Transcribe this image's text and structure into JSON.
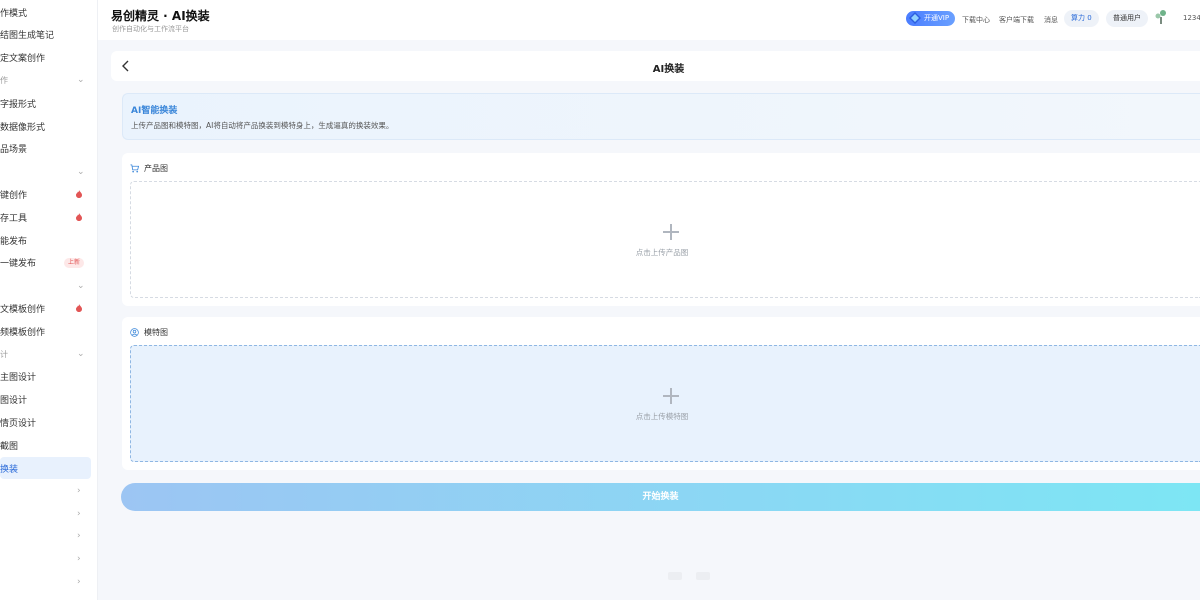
{
  "sidebar": {
    "items": [
      {
        "label": "作模式",
        "kind": "item"
      },
      {
        "label": "结图生成笔记",
        "kind": "item"
      },
      {
        "label": "定文案创作",
        "kind": "item"
      },
      {
        "label": "作",
        "kind": "group",
        "chevron": "v"
      },
      {
        "label": "字报形式",
        "kind": "item"
      },
      {
        "label": "数据像形式",
        "kind": "item"
      },
      {
        "label": "品场景",
        "kind": "item"
      },
      {
        "label": "",
        "kind": "group",
        "chevron": "v"
      },
      {
        "label": "键创作",
        "kind": "item",
        "fire": true
      },
      {
        "label": "存工具",
        "kind": "item",
        "fire": true
      },
      {
        "label": "能发布",
        "kind": "item"
      },
      {
        "label": "一键发布",
        "kind": "item",
        "badge": "上新"
      },
      {
        "label": "",
        "kind": "group",
        "chevron": "v"
      },
      {
        "label": "文模板创作",
        "kind": "item",
        "fire": true
      },
      {
        "label": "频模板创作",
        "kind": "item"
      },
      {
        "label": "计",
        "kind": "group",
        "chevron": "v"
      },
      {
        "label": "主图设计",
        "kind": "item"
      },
      {
        "label": "图设计",
        "kind": "item"
      },
      {
        "label": "情页设计",
        "kind": "item"
      },
      {
        "label": "截图",
        "kind": "item"
      },
      {
        "label": "换装",
        "kind": "item",
        "active": true
      },
      {
        "label": "",
        "kind": "group",
        "chevron": ">"
      },
      {
        "label": "",
        "kind": "group",
        "chevron": ">"
      },
      {
        "label": "",
        "kind": "group",
        "chevron": ">"
      },
      {
        "label": "",
        "kind": "group",
        "chevron": ">"
      },
      {
        "label": "",
        "kind": "group",
        "chevron": ">"
      }
    ]
  },
  "header": {
    "title": "易创精灵 · AI换装",
    "subtitle": "创作自动化与工作流平台",
    "vip_label": "开通VIP",
    "download_center": "下载中心",
    "client_download": "客户端下载",
    "messages": "消息",
    "power_label": "算力 0",
    "user_type": "普通用户",
    "user_id": "1234"
  },
  "main": {
    "page_title": "AI换装",
    "info": {
      "title": "AI智能换装",
      "description": "上传产品图和模特图，AI将自动将产品换装到模特身上，生成逼真的换装效果。"
    },
    "product": {
      "label": "产品图",
      "upload_hint": "点击上传产品图"
    },
    "model": {
      "label": "模特图",
      "upload_hint": "点击上传模特图"
    },
    "start_button": "开始换装"
  },
  "colors": {
    "accent": "#3a86d9",
    "vip": "#4a7dff",
    "active_bg": "#e8f1fd",
    "fire": "#e25555"
  }
}
